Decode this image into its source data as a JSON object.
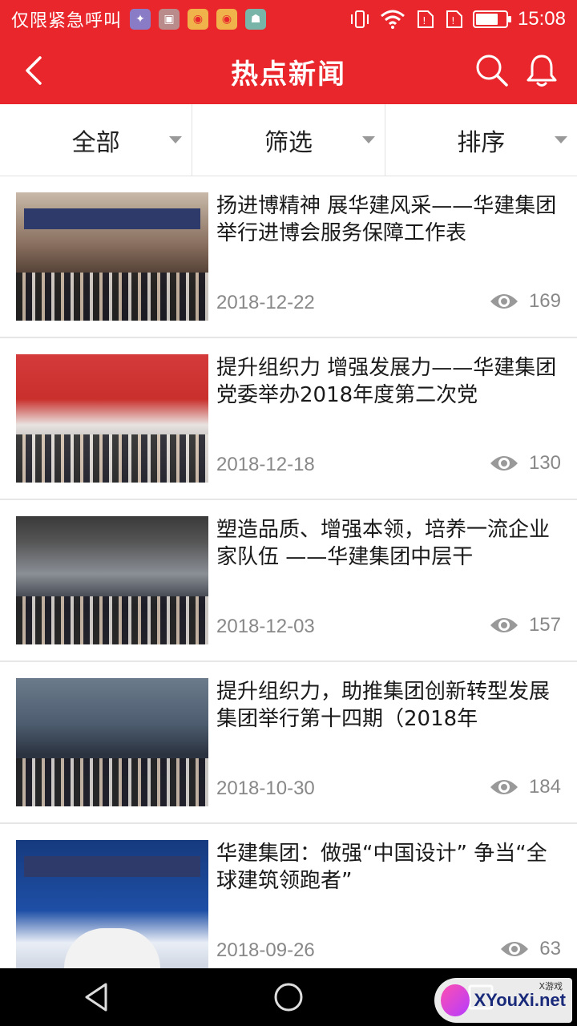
{
  "status_bar": {
    "carrier": "仅限紧急呼叫",
    "time": "15:08",
    "battery_level": 0.75,
    "notification_icons": [
      "app-icon",
      "image-icon",
      "weibo-icon",
      "weibo-icon",
      "android-icon"
    ]
  },
  "header": {
    "title": "热点新闻",
    "back_icon": "back-arrow-icon",
    "search_icon": "search-icon",
    "bell_icon": "bell-icon"
  },
  "filters": [
    {
      "label": "全部"
    },
    {
      "label": "筛选"
    },
    {
      "label": "排序"
    }
  ],
  "news": [
    {
      "title": "扬进博精神 展华建风采——华建集团举行进博会服务保障工作表",
      "date": "2018-12-22",
      "views": "169"
    },
    {
      "title": "提升组织力 增强发展力——华建集团党委举办2018年度第二次党",
      "date": "2018-12-18",
      "views": "130"
    },
    {
      "title": "塑造品质、增强本领，培养一流企业家队伍 ——华建集团中层干",
      "date": "2018-12-03",
      "views": "157"
    },
    {
      "title": "提升组织力，助推集团创新转型发展 集团举行第十四期（2018年",
      "date": "2018-10-30",
      "views": "184"
    },
    {
      "title": "华建集团：做强“中国设计” 争当“全球建筑领跑者”",
      "date": "2018-09-26",
      "views": "63"
    }
  ],
  "watermark": {
    "text": "XYouXi.net",
    "small": "X游戏"
  },
  "colors": {
    "accent": "#e8262b",
    "muted": "#888888"
  }
}
